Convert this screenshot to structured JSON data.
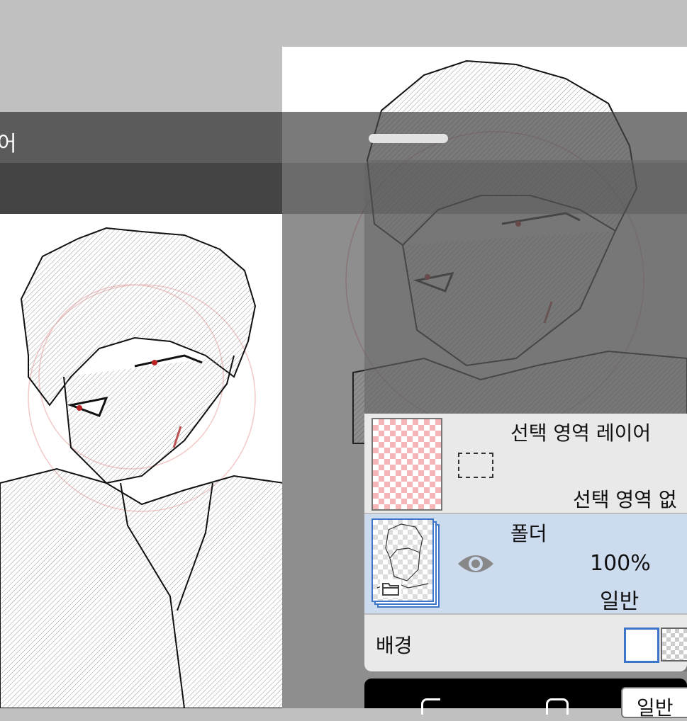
{
  "header": {
    "title_fragment": "어"
  },
  "layers_panel": {
    "selection_layer": {
      "name": "선택 영역 레이어",
      "status": "선택 영역 없"
    },
    "folder_layer": {
      "name": "폴더",
      "opacity": "100%",
      "blend_mode": "일반",
      "visibility_icon": "eye-icon",
      "type_icon": "folder-icon"
    },
    "background": {
      "label": "배경"
    }
  },
  "bottom_bar": {
    "mode_fragment": "일반"
  },
  "colors": {
    "accent": "#3d76c9",
    "selected_row": "#cddbef",
    "header_bg": "#5b5b5b",
    "toolbar_bg": "#444444",
    "eye_color": "#888888",
    "sketch_red": "#f3c8c8"
  }
}
